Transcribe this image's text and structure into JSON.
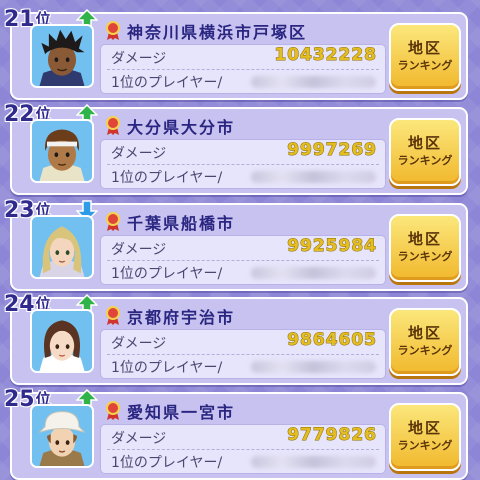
{
  "rank_unit": "位",
  "damage_label": "ダメージ",
  "player_label": "1位のプレイヤー/",
  "button": {
    "line1": "地区",
    "line2": "ランキング"
  },
  "colors": {
    "up_arrow": "#30b44a",
    "down_arrow": "#2e9be6",
    "accent_gold": "#f1c232",
    "rank_text": "#2f2a8c"
  },
  "entries": [
    {
      "rank": "21",
      "trend": "up",
      "city": "神奈川県横浜市戸塚区",
      "damage": "10432228",
      "avatar": "dark-skinned-dreadlocked-boy"
    },
    {
      "rank": "22",
      "trend": "up",
      "city": "大分県大分市",
      "damage": "9997269",
      "avatar": "brown-haired-boy-headband"
    },
    {
      "rank": "23",
      "trend": "down",
      "city": "千葉県船橋市",
      "damage": "9925984",
      "avatar": "blonde-long-haired-boy"
    },
    {
      "rank": "24",
      "trend": "up",
      "city": "京都府宇治市",
      "damage": "9864605",
      "avatar": "brown-haired-girl"
    },
    {
      "rank": "25",
      "trend": "up",
      "city": "愛知県一宮市",
      "damage": "9779826",
      "avatar": "white-hat-boy"
    }
  ]
}
